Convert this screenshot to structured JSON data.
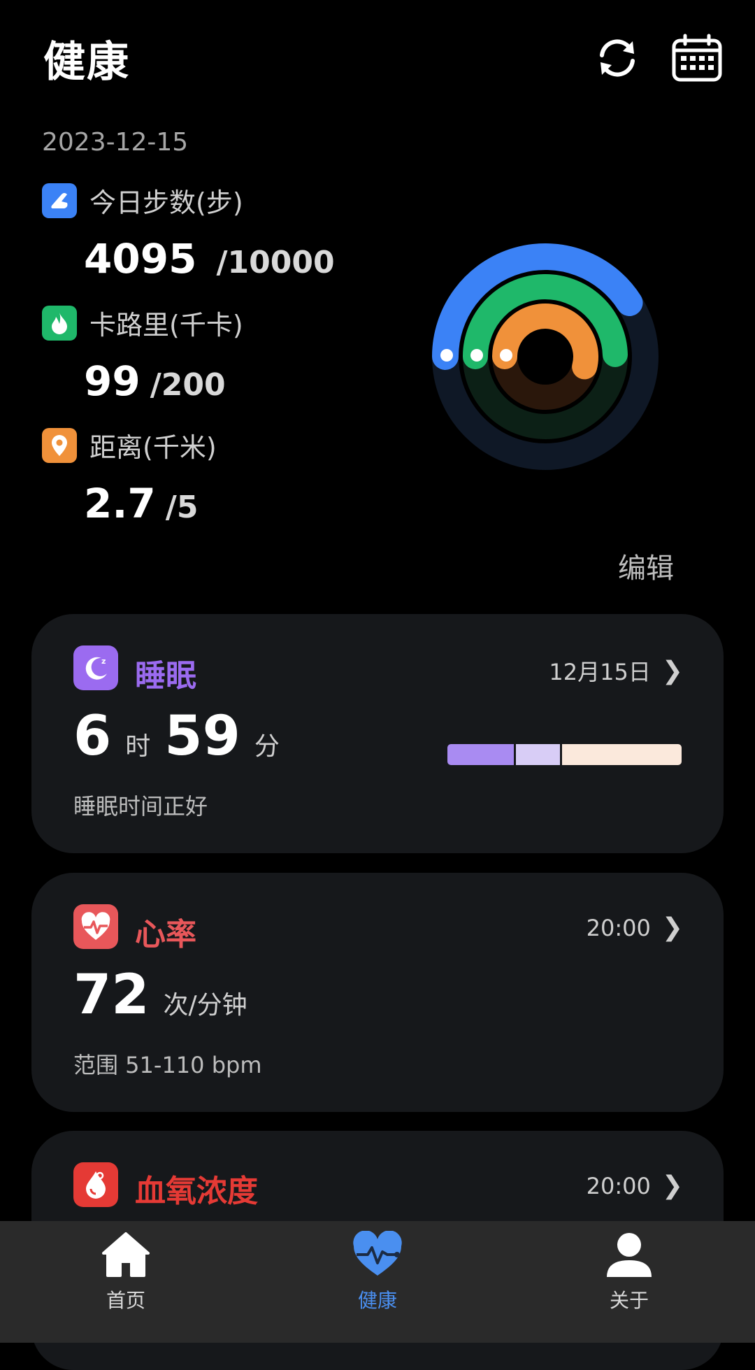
{
  "header": {
    "title": "健康",
    "sync_icon": "sync-icon",
    "calendar_icon": "calendar-icon"
  },
  "date": "2023-12-15",
  "metrics": [
    {
      "label": "今日步数(步)",
      "value": "4095",
      "goal": "/10000",
      "icon": "shoe-icon",
      "color": "#3b82f6",
      "progress": 0.4095
    },
    {
      "label": "卡路里(千卡)",
      "value": "99",
      "goal": "/200",
      "icon": "flame-icon",
      "color": "#1fb86a",
      "progress": 0.495
    },
    {
      "label": "距离(千米)",
      "value": "2.7",
      "goal": "/5",
      "icon": "location-icon",
      "color": "#f0913a",
      "progress": 0.54
    }
  ],
  "edit_label": "编辑",
  "sleep": {
    "title": "睡眠",
    "date": "12月15日",
    "hours": "6",
    "hours_unit": "时",
    "minutes": "59",
    "minutes_unit": "分",
    "status": "睡眠时间正好",
    "color": "#9b6bf0",
    "bar_segments": [
      {
        "color": "#a98bf2",
        "fraction": 0.29
      },
      {
        "color": "#d8cdf6",
        "fraction": 0.19
      },
      {
        "color": "#fbe9dc",
        "fraction": 0.52
      }
    ]
  },
  "heart": {
    "title": "心率",
    "time": "20:00",
    "value": "72",
    "unit": "次/分钟",
    "range": "范围 51-110 bpm",
    "color": "#e8575a"
  },
  "oxygen": {
    "title": "血氧浓度",
    "time": "20:00",
    "color": "#e53a35"
  },
  "nav": [
    {
      "label": "首页",
      "icon": "home-icon",
      "active": false
    },
    {
      "label": "健康",
      "icon": "heart-pulse-icon",
      "active": true
    },
    {
      "label": "关于",
      "icon": "person-icon",
      "active": false
    }
  ],
  "colors": {
    "accent": "#4a8ff0",
    "background": "#000000",
    "card": "#16181b"
  }
}
